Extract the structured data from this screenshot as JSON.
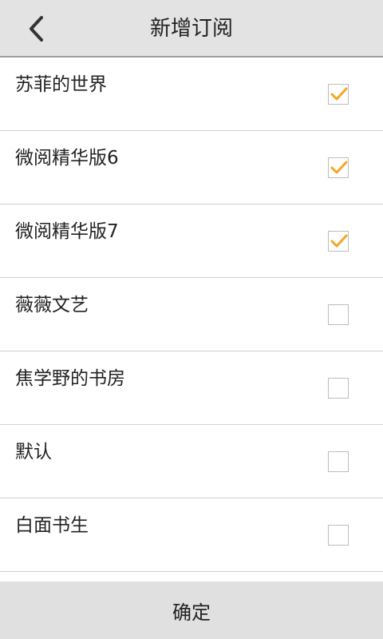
{
  "header": {
    "back_icon": "chevron-left-icon",
    "title": "新增订阅"
  },
  "subscriptions": [
    {
      "label": "苏菲的世界",
      "checked": true
    },
    {
      "label": "微阅精华版6",
      "checked": true
    },
    {
      "label": "微阅精华版7",
      "checked": true
    },
    {
      "label": "薇薇文艺",
      "checked": false
    },
    {
      "label": "焦学野的书房",
      "checked": false
    },
    {
      "label": "默认",
      "checked": false
    },
    {
      "label": "白面书生",
      "checked": false
    }
  ],
  "footer": {
    "confirm_label": "确定"
  },
  "colors": {
    "check_accent": "#f5a623",
    "header_bg": "#e3e3e3",
    "footer_bg": "#e0e0e0"
  }
}
